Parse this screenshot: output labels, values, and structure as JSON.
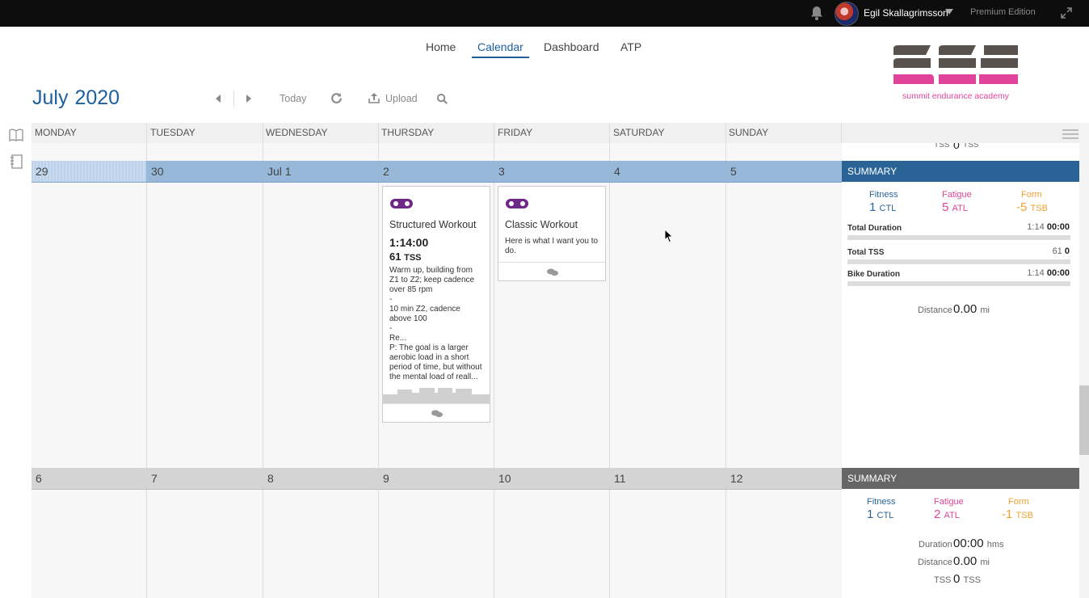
{
  "topbar": {
    "username": "Egil Skallagrimsson",
    "edition": "Premium Edition"
  },
  "nav": {
    "items": [
      {
        "label": "Home"
      },
      {
        "label": "Calendar",
        "active": true
      },
      {
        "label": "Dashboard"
      },
      {
        "label": "ATP"
      }
    ]
  },
  "logo": {
    "text": "summit endurance academy",
    "colors": {
      "dark": "#58514e",
      "pink": "#e0449a"
    }
  },
  "calendar": {
    "month": "July",
    "year": "2020",
    "controls": {
      "today": "Today",
      "upload": "Upload"
    },
    "days": [
      "MONDAY",
      "TUESDAY",
      "WEDNESDAY",
      "THURSDAY",
      "FRIDAY",
      "SATURDAY",
      "SUNDAY"
    ],
    "partial_row_tss": {
      "label": "TSS",
      "value": "0",
      "unit": "TSS"
    },
    "weeks": [
      {
        "dates": [
          "29",
          "30",
          "Jul 1",
          "2",
          "3",
          "4",
          "5"
        ],
        "summary": {
          "title": "SUMMARY",
          "fitness_label": "Fitness",
          "fitness_value": "1",
          "fitness_unit": "CTL",
          "fatigue_label": "Fatigue",
          "fatigue_value": "5",
          "fatigue_unit": "ATL",
          "form_label": "Form",
          "form_value": "-5",
          "form_unit": "TSB",
          "total_duration_label": "Total Duration",
          "total_duration_planned": "1:14",
          "total_duration_actual": "00:00",
          "total_tss_label": "Total TSS",
          "total_tss_planned": "61",
          "total_tss_actual": "0",
          "bike_duration_label": "Bike Duration",
          "bike_duration_planned": "1:14",
          "bike_duration_actual": "00:00",
          "distance_label": "Distance",
          "distance_value": "0.00",
          "distance_unit": "mi"
        },
        "workouts": [
          {
            "title": "Structured Workout",
            "duration": "1:14:00",
            "tss": "61",
            "tss_unit": "TSS",
            "description": "Warm up, building from\nZ1 to Z2; keep cadence\nover 85 rpm\n-\n10 min Z2, cadence\nabove 100\n-\nRe...\nP: The goal is a larger\naerobic load in a short\nperiod of time, but without\nthe mental load of reall..."
          },
          {
            "title": "Classic Workout",
            "description": "Here is what I want you to\ndo."
          }
        ]
      },
      {
        "dates": [
          "6",
          "7",
          "8",
          "9",
          "10",
          "11",
          "12"
        ],
        "summary": {
          "title": "SUMMARY",
          "fitness_label": "Fitness",
          "fitness_value": "1",
          "fitness_unit": "CTL",
          "fatigue_label": "Fatigue",
          "fatigue_value": "2",
          "fatigue_unit": "ATL",
          "form_label": "Form",
          "form_value": "-1",
          "form_unit": "TSB",
          "duration_label": "Duration",
          "duration_value": "00:00",
          "duration_unit": "hms",
          "distance_label": "Distance",
          "distance_value": "0.00",
          "distance_unit": "mi",
          "tss_label": "TSS",
          "tss_value": "0",
          "tss_unit": "TSS"
        }
      }
    ]
  },
  "colors": {
    "accent": "#1d5f9f",
    "current_week_bar": "#97b8d9",
    "summary_blue": "#2a6496",
    "summary_gray": "#666666",
    "fitness": "#2a6496",
    "fatigue": "#e0449a",
    "form": "#f0a030",
    "workout_icon": "#6c2a86"
  }
}
